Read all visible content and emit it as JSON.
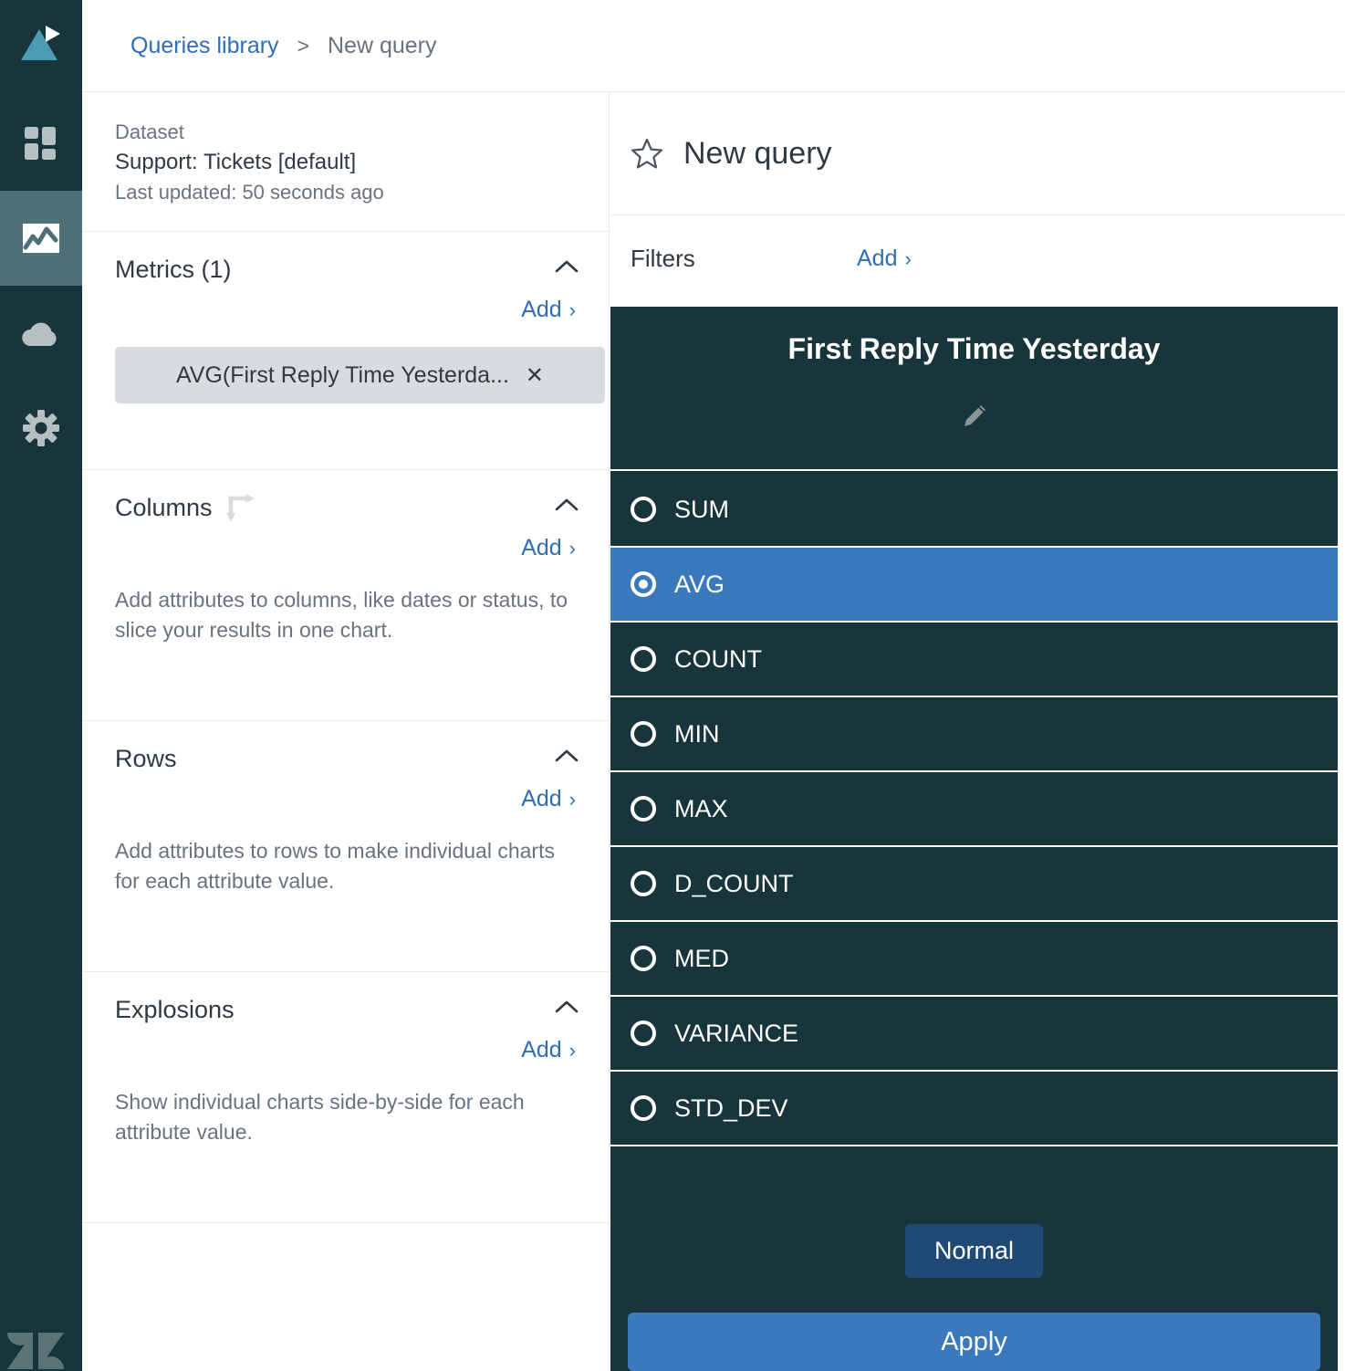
{
  "sidebar": {
    "items": [
      {
        "name": "logo",
        "icon": "explore-logo-icon",
        "active": false
      },
      {
        "name": "dashboards",
        "icon": "dashboard-grid-icon",
        "active": false
      },
      {
        "name": "reports",
        "icon": "chart-reports-icon",
        "active": true
      },
      {
        "name": "datasets",
        "icon": "cloud-upload-icon",
        "active": false
      },
      {
        "name": "settings",
        "icon": "gear-icon",
        "active": false
      }
    ],
    "footer_logo": "zendesk-logo-icon"
  },
  "breadcrumb": {
    "parent": "Queries library",
    "separator": ">",
    "current": "New query"
  },
  "dataset": {
    "label": "Dataset",
    "name": "Support: Tickets [default]",
    "last_updated": "Last updated: 50 seconds ago"
  },
  "sections": {
    "metrics": {
      "title": "Metrics (1)",
      "add_label": "Add",
      "add_caret": "›",
      "collapse_icon": "chevron-up-icon",
      "chips": [
        {
          "label": "AVG(First Reply Time Yesterda...",
          "remove": "✕"
        }
      ]
    },
    "columns": {
      "title": "Columns",
      "header_icon": "swap-transpose-icon",
      "add_label": "Add",
      "add_caret": "›",
      "collapse_icon": "chevron-up-icon",
      "description": "Add attributes to columns, like dates or status, to slice your results in one chart."
    },
    "rows": {
      "title": "Rows",
      "add_label": "Add",
      "add_caret": "›",
      "collapse_icon": "chevron-up-icon",
      "description": "Add attributes to rows to make individual charts for each attribute value."
    },
    "explosions": {
      "title": "Explosions",
      "add_label": "Add",
      "add_caret": "›",
      "collapse_icon": "chevron-up-icon",
      "description": "Show individual charts side-by-side for each attribute value."
    }
  },
  "query_panel": {
    "star_icon": "star-outline-icon",
    "title": "New query",
    "filters_label": "Filters",
    "filters_add_label": "Add",
    "filters_add_caret": "›"
  },
  "aggregator_popover": {
    "title": "First Reply Time Yesterday",
    "edit_icon": "pencil-edit-icon",
    "options": [
      {
        "label": "SUM",
        "selected": false
      },
      {
        "label": "AVG",
        "selected": true
      },
      {
        "label": "COUNT",
        "selected": false
      },
      {
        "label": "MIN",
        "selected": false
      },
      {
        "label": "MAX",
        "selected": false
      },
      {
        "label": "D_COUNT",
        "selected": false
      },
      {
        "label": "MED",
        "selected": false
      },
      {
        "label": "VARIANCE",
        "selected": false
      },
      {
        "label": "STD_DEV",
        "selected": false
      }
    ],
    "normal_button": "Normal",
    "apply_button": "Apply"
  },
  "colors": {
    "rail": "#17353a",
    "rail_active": "#4d7176",
    "accent_blue": "#2f6eb5",
    "selected_row": "#3a79bb",
    "normal_button": "#204a75",
    "panel_dark": "#17353a",
    "chip": "#d8dcde",
    "text_dark": "#2f3941",
    "text_muted": "#68737d"
  }
}
